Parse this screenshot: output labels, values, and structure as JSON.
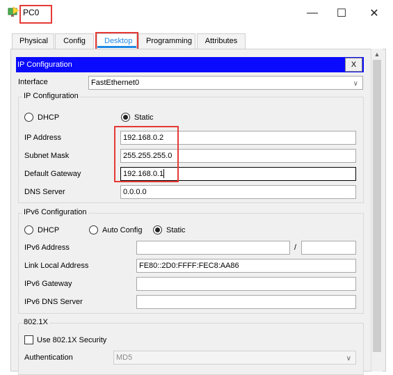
{
  "window": {
    "title": "PC0",
    "minimize": "—",
    "maximize": "☐",
    "close": "✕"
  },
  "tabs": [
    {
      "label": "Physical"
    },
    {
      "label": "Config"
    },
    {
      "label": "Desktop",
      "active": true
    },
    {
      "label": "Programming"
    },
    {
      "label": "Attributes"
    }
  ],
  "header": {
    "title": "IP Configuration",
    "close_label": "X"
  },
  "interface": {
    "label": "Interface",
    "value": "FastEthernet0"
  },
  "ipv4": {
    "group_label": "IP Configuration",
    "dhcp_label": "DHCP",
    "static_label": "Static",
    "mode": "Static",
    "ip_label": "IP Address",
    "ip_value": "192.168.0.2",
    "mask_label": "Subnet Mask",
    "mask_value": "255.255.255.0",
    "gateway_label": "Default Gateway",
    "gateway_value": "192.168.0.1",
    "dns_label": "DNS Server",
    "dns_value": "0.0.0.0"
  },
  "ipv6": {
    "group_label": "IPv6 Configuration",
    "dhcp_label": "DHCP",
    "auto_label": "Auto Config",
    "static_label": "Static",
    "mode": "Static",
    "addr_label": "IPv6 Address",
    "addr_value": "",
    "prefix_sep": "/",
    "prefix_value": "",
    "link_local_label": "Link Local Address",
    "link_local_value": "FE80::2D0:FFFF:FEC8:AA86",
    "gateway_label": "IPv6 Gateway",
    "gateway_value": "",
    "dns_label": "IPv6 DNS Server",
    "dns_value": ""
  },
  "dot1x": {
    "group_label": "802.1X",
    "use_label": "Use 802.1X Security",
    "auth_label": "Authentication",
    "auth_value": "MD5"
  },
  "colors": {
    "header_bar": "#0a0aff",
    "highlight": "#e53935",
    "active_tab": "#1e88e5"
  }
}
